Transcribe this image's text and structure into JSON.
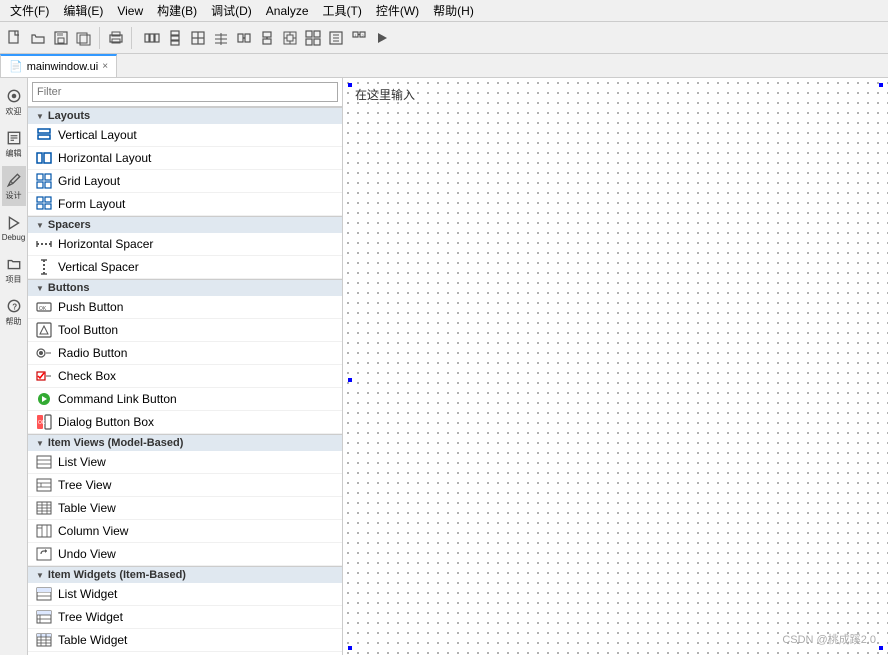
{
  "menu": {
    "items": [
      "文件(F)",
      "编辑(E)",
      "View",
      "构建(B)",
      "调试(D)",
      "Analyze",
      "工具(T)",
      "控件(W)",
      "帮助(H)"
    ]
  },
  "tab": {
    "icon": "📄",
    "label": "mainwindow.ui",
    "close_label": "×"
  },
  "filter": {
    "placeholder": "Filter"
  },
  "canvas": {
    "placeholder": "在这里输入"
  },
  "sidebar_icons": [
    {
      "name": "欢迎",
      "label": "欢迎"
    },
    {
      "name": "编辑",
      "label": "编辑"
    },
    {
      "name": "设计",
      "label": "设计"
    },
    {
      "name": "Debug",
      "label": "Debug"
    },
    {
      "name": "项目",
      "label": "项目"
    },
    {
      "name": "帮助",
      "label": "帮助"
    }
  ],
  "widget_categories": [
    {
      "name": "Layouts",
      "items": [
        {
          "label": "Vertical Layout",
          "icon": "vl"
        },
        {
          "label": "Horizontal Layout",
          "icon": "hl"
        },
        {
          "label": "Grid Layout",
          "icon": "gl"
        },
        {
          "label": "Form Layout",
          "icon": "fl"
        }
      ]
    },
    {
      "name": "Spacers",
      "items": [
        {
          "label": "Horizontal Spacer",
          "icon": "hs"
        },
        {
          "label": "Vertical Spacer",
          "icon": "vs"
        }
      ]
    },
    {
      "name": "Buttons",
      "items": [
        {
          "label": "Push Button",
          "icon": "pb"
        },
        {
          "label": "Tool Button",
          "icon": "tb"
        },
        {
          "label": "Radio Button",
          "icon": "rb"
        },
        {
          "label": "Check Box",
          "icon": "cb"
        },
        {
          "label": "Command Link Button",
          "icon": "cl"
        },
        {
          "label": "Dialog Button Box",
          "icon": "db"
        }
      ]
    },
    {
      "name": "Item Views (Model-Based)",
      "items": [
        {
          "label": "List View",
          "icon": "lv"
        },
        {
          "label": "Tree View",
          "icon": "tv"
        },
        {
          "label": "Table View",
          "icon": "tav"
        },
        {
          "label": "Column View",
          "icon": "cv"
        },
        {
          "label": "Undo View",
          "icon": "uv"
        }
      ]
    },
    {
      "name": "Item Widgets (Item-Based)",
      "items": [
        {
          "label": "List Widget",
          "icon": "lw"
        },
        {
          "label": "Tree Widget",
          "icon": "tw"
        },
        {
          "label": "Table Widget",
          "icon": "taw"
        }
      ]
    }
  ],
  "status": {
    "watermark": "CSDN @桃成蹊2.0"
  }
}
